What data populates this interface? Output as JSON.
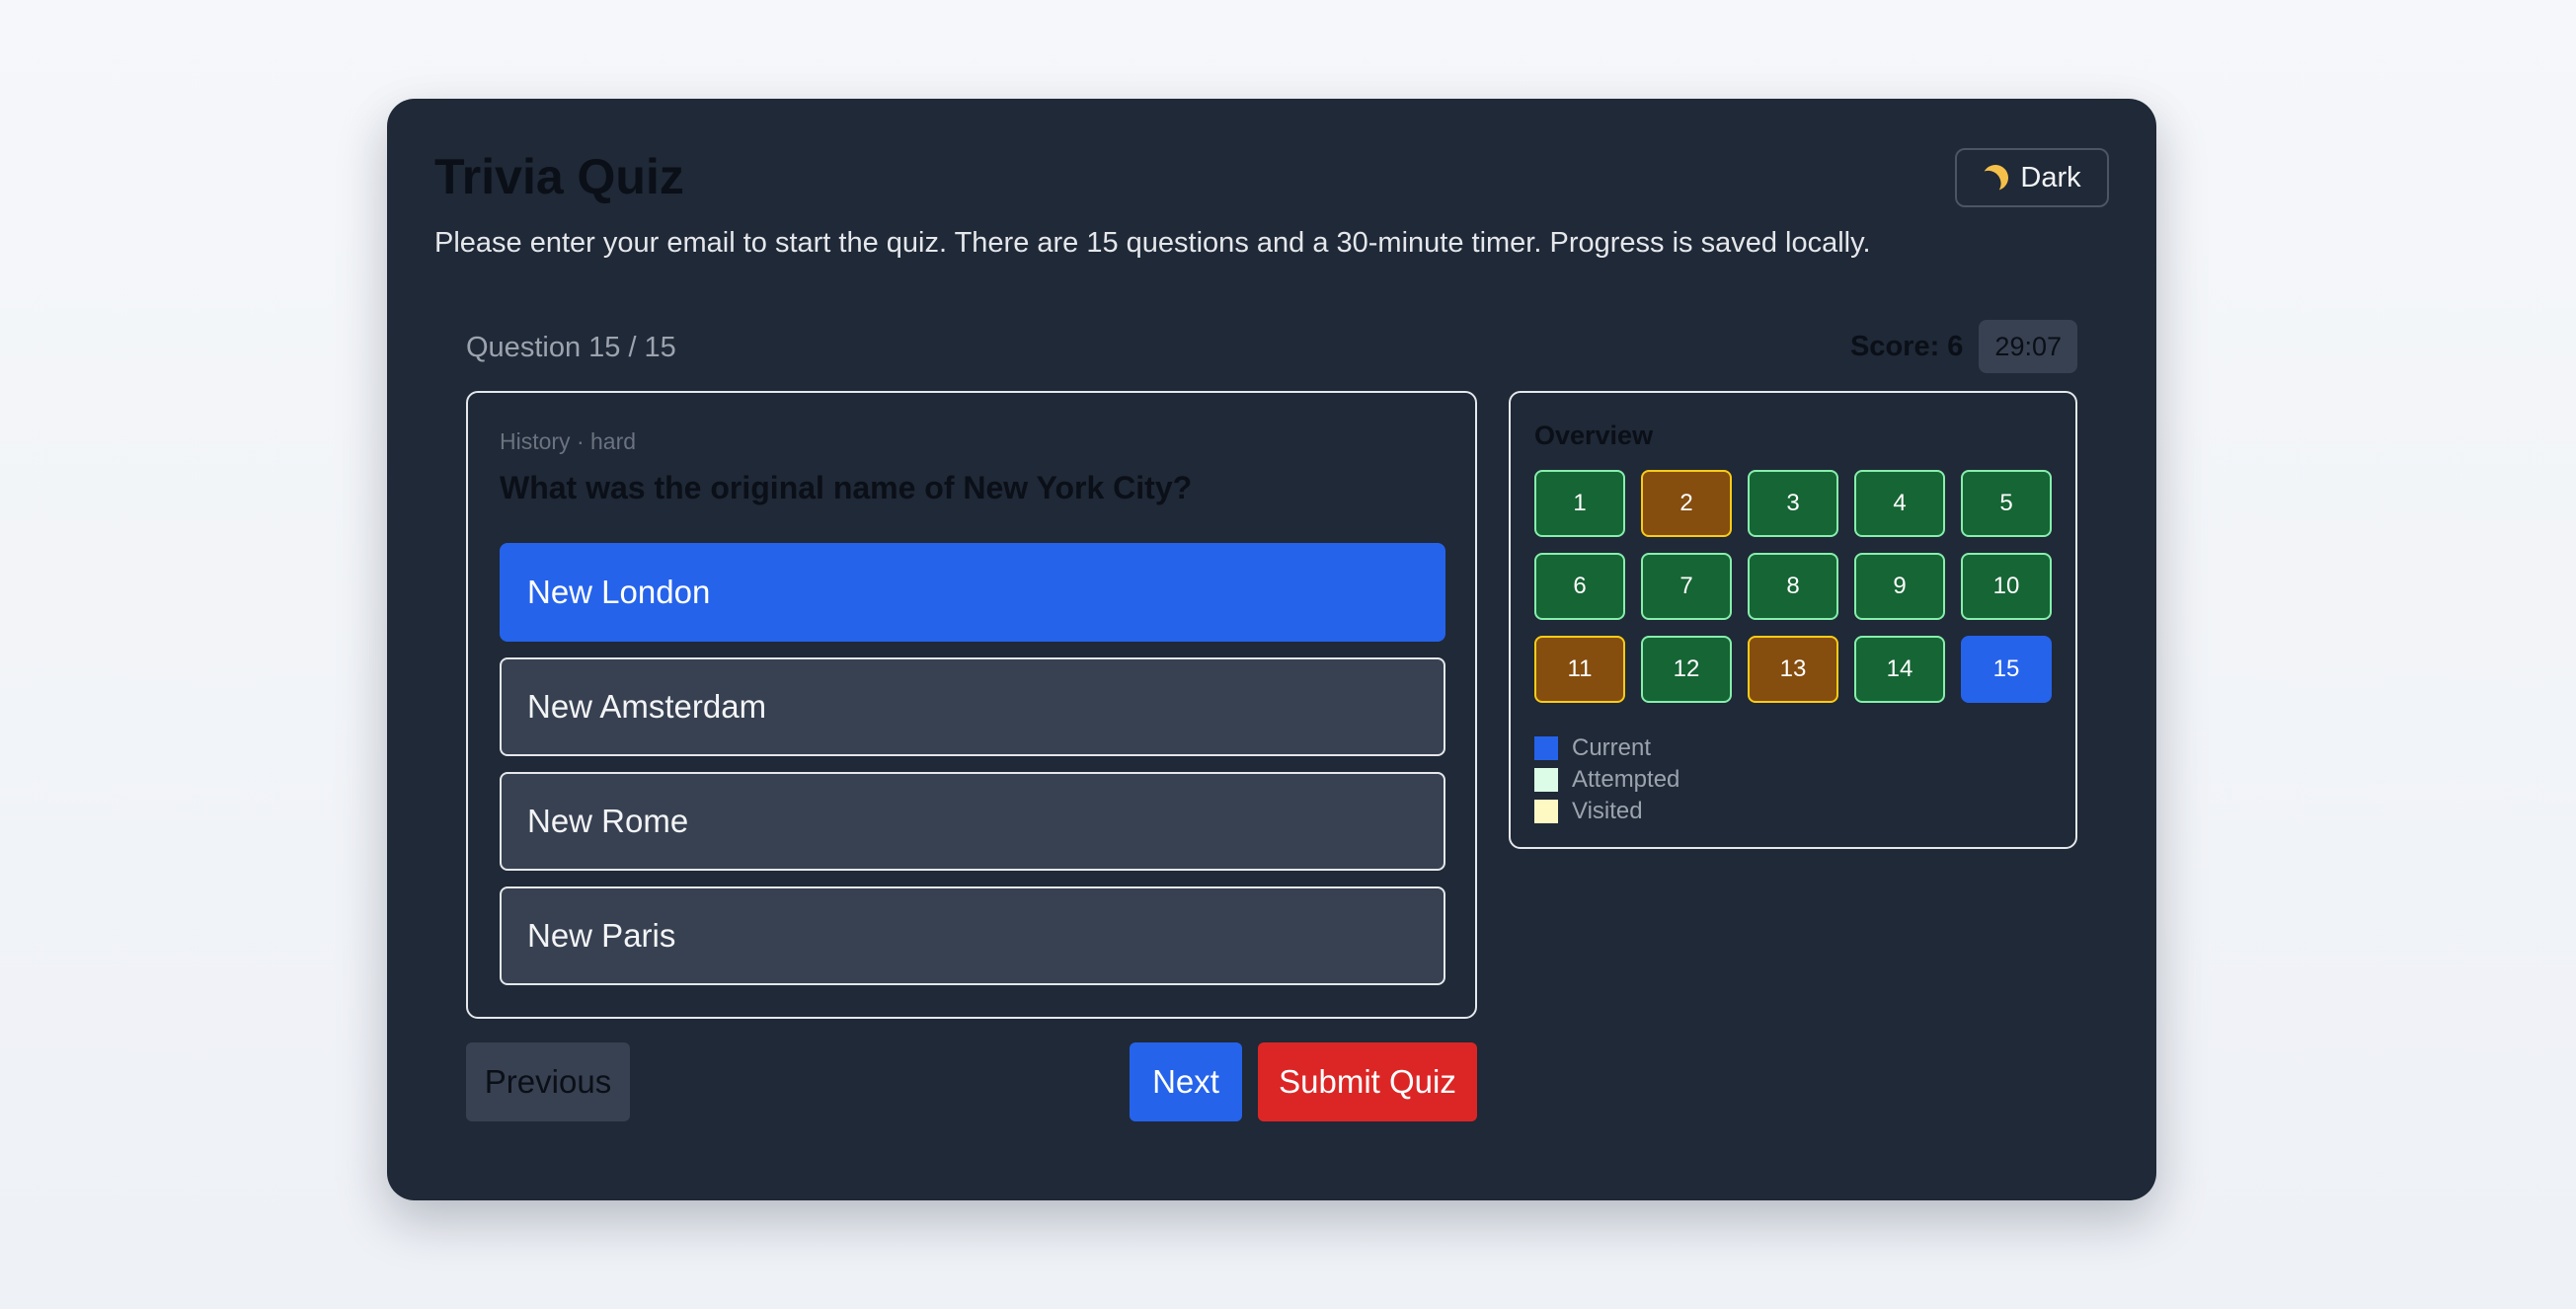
{
  "header": {
    "title": "Trivia Quiz",
    "intro": "Please enter your email to start the quiz. There are 15 questions and a 30-minute timer. Progress is saved locally.",
    "theme_toggle_label": "Dark"
  },
  "status": {
    "counter": "Question 15 / 15",
    "score": "Score: 6",
    "timer": "29:07"
  },
  "question": {
    "meta": "History · hard",
    "text": "What was the original name of New York City?",
    "options": [
      {
        "label": "New London",
        "selected": true
      },
      {
        "label": "New Amsterdam",
        "selected": false
      },
      {
        "label": "New Rome",
        "selected": false
      },
      {
        "label": "New Paris",
        "selected": false
      }
    ]
  },
  "overview": {
    "title": "Overview",
    "items": [
      {
        "label": "1",
        "state": "attempted"
      },
      {
        "label": "2",
        "state": "visited"
      },
      {
        "label": "3",
        "state": "attempted"
      },
      {
        "label": "4",
        "state": "attempted"
      },
      {
        "label": "5",
        "state": "attempted"
      },
      {
        "label": "6",
        "state": "attempted"
      },
      {
        "label": "7",
        "state": "attempted"
      },
      {
        "label": "8",
        "state": "attempted"
      },
      {
        "label": "9",
        "state": "attempted"
      },
      {
        "label": "10",
        "state": "attempted"
      },
      {
        "label": "11",
        "state": "visited"
      },
      {
        "label": "12",
        "state": "attempted"
      },
      {
        "label": "13",
        "state": "visited"
      },
      {
        "label": "14",
        "state": "attempted"
      },
      {
        "label": "15",
        "state": "current"
      }
    ],
    "legend": [
      {
        "label": "Current",
        "color": "#2563eb"
      },
      {
        "label": "Attempted",
        "color": "#dcfce7"
      },
      {
        "label": "Visited",
        "color": "#fef9c3"
      }
    ]
  },
  "nav": {
    "previous": "Previous",
    "next": "Next",
    "submit": "Submit Quiz"
  },
  "icons": {
    "theme_toggle": "moon-icon"
  }
}
